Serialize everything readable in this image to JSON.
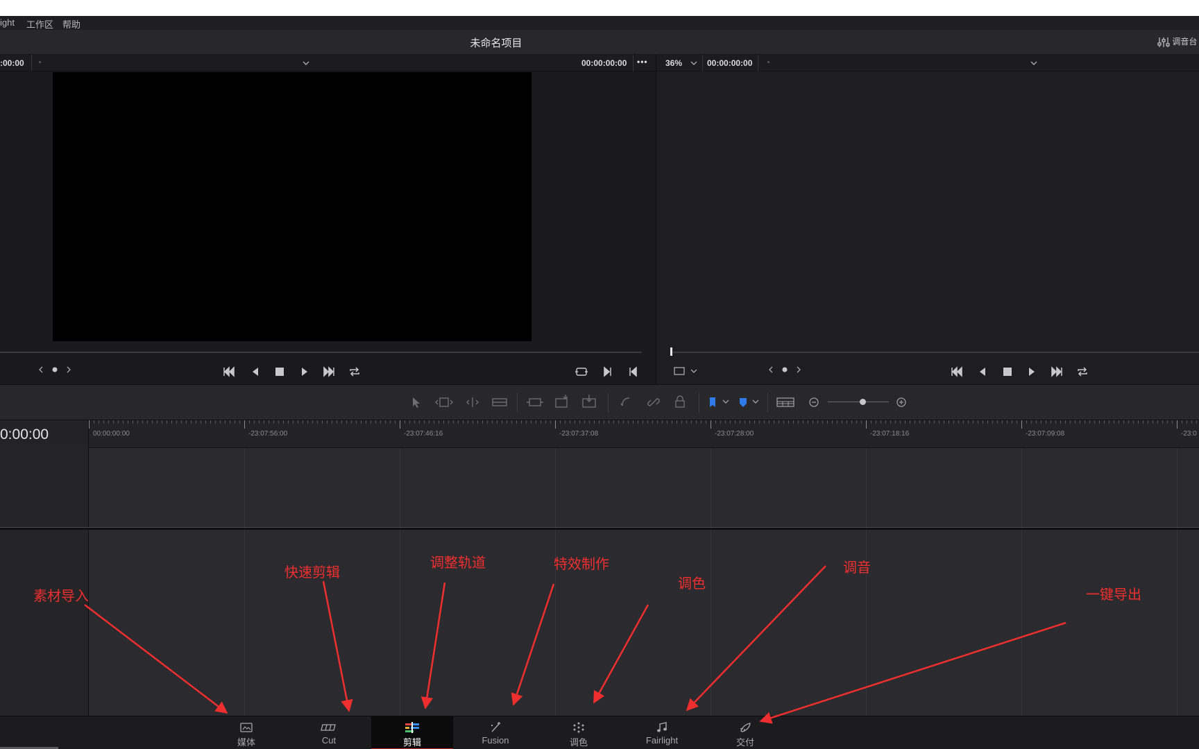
{
  "menu": {
    "items": [
      "ight",
      "工作区",
      "帮助"
    ]
  },
  "title": {
    "project_name": "未命名项目",
    "mixer_label": "调音台"
  },
  "source_viewer": {
    "timecode_in": ":00:00",
    "timecode_out": "00:00:00:00",
    "more_label": "•••"
  },
  "timeline_viewer": {
    "zoom": "36%",
    "timecode": "00:00:00:00"
  },
  "timeline": {
    "timecode": "0:00:00",
    "ruler_labels": [
      "00:00:00:00",
      "-23:07:56:00",
      "-23:07:46:16",
      "-23:07:37:08",
      "-23:07:28:00",
      "-23:07:18:16",
      "-23:07:09:08",
      "-23:0"
    ]
  },
  "pages": [
    {
      "label": "媒体",
      "icon": "media-icon",
      "active": false
    },
    {
      "label": "Cut",
      "icon": "cut-icon",
      "active": false
    },
    {
      "label": "剪辑",
      "icon": "edit-icon",
      "active": true
    },
    {
      "label": "Fusion",
      "icon": "fusion-icon",
      "active": false
    },
    {
      "label": "调色",
      "icon": "color-icon",
      "active": false
    },
    {
      "label": "Fairlight",
      "icon": "fairlight-icon",
      "active": false
    },
    {
      "label": "交付",
      "icon": "deliver-icon",
      "active": false
    }
  ],
  "annotations": {
    "color_hex": "#ef2f2f",
    "items": [
      "素材导入",
      "快速剪辑",
      "调整轨道",
      "特效制作",
      "调色",
      "调音",
      "一键导出"
    ]
  }
}
